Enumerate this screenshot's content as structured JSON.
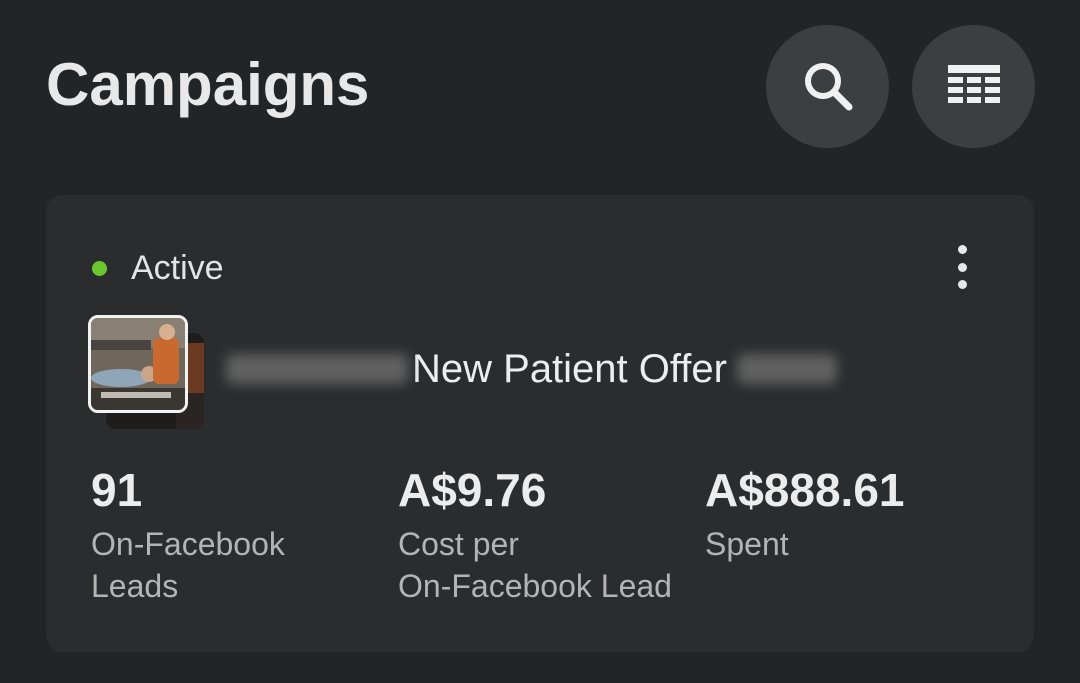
{
  "header": {
    "title": "Campaigns",
    "search_icon": "search-icon",
    "table_icon": "table-view-icon"
  },
  "campaign": {
    "status": "Active",
    "status_color": "#6ac82e",
    "name": "New Patient Offer",
    "more_icon": "more-vertical-icon",
    "metrics": [
      {
        "value": "91",
        "label": "On-Facebook\nLeads"
      },
      {
        "value": "A$9.76",
        "label": "Cost per\nOn-Facebook Lead"
      },
      {
        "value": "A$888.61",
        "label": "Spent"
      }
    ]
  },
  "colors": {
    "background": "#232425",
    "card": "#2b2c2d",
    "icon_button": "#3d3e3f",
    "active_dot": "#6ac82e"
  }
}
